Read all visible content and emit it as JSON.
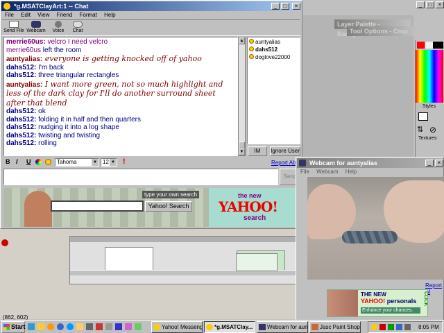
{
  "desktop": {
    "status_coords": "(862, 602)"
  },
  "chat_window": {
    "title": "*g.MSATClayArt:1 -- Chat",
    "menu": [
      "File",
      "Edit",
      "View",
      "Friend",
      "Format",
      "Help"
    ],
    "toolbar": [
      "Send File",
      "Webcam",
      "Voice",
      "Chat"
    ],
    "messages": [
      {
        "name": "merrie60us:",
        "text": " velcro I need velcro",
        "style": "merrie"
      },
      {
        "name": "merrie60us",
        "text": " left the room",
        "style": "system"
      },
      {
        "name": "auntyalias:",
        "text": " everyone is getting knocked off of yahoo",
        "style": "aunty"
      },
      {
        "name": "dahs512:",
        "text": " I'm back",
        "style": "dahs"
      },
      {
        "name": "dahs512:",
        "text": " three triangular rectangles",
        "style": "dahs"
      },
      {
        "name": "auntyalias:",
        "text": " I want more green, not so much highlight and",
        "style": "aunty"
      },
      {
        "name": "",
        "text": " less of the dark clay for I'll do another surround sheet",
        "style": "aunty-cont"
      },
      {
        "name": "",
        "text": " after that blend",
        "style": "aunty-cont"
      },
      {
        "name": "dahs512:",
        "text": " ok",
        "style": "dahs"
      },
      {
        "name": "dahs512:",
        "text": " folding it in half and then quarters",
        "style": "dahs"
      },
      {
        "name": "dahs512:",
        "text": " nudging it into a log shape",
        "style": "dahs"
      },
      {
        "name": "dahs512:",
        "text": " twisting and twisting",
        "style": "dahs"
      },
      {
        "name": "dahs512:",
        "text": " rolling",
        "style": "dahs"
      }
    ],
    "users": [
      "auntyalias",
      "dahs512",
      "doglove22000"
    ],
    "im_button": "IM",
    "ignore_button": "Ignore User",
    "format": {
      "bold": "B",
      "italic": "I",
      "underline": "U",
      "font": "Tahoma",
      "size": "12"
    },
    "report_abuse": "Report Abu",
    "send_label": "Send",
    "ad": {
      "prompt": "type your own search",
      "search_button": "Yahoo! Search",
      "the_new": "the new",
      "brand": "YAHOO!",
      "search": "search"
    }
  },
  "psp": {
    "layer_palette": "Layer Palette - Background",
    "tool_options": "Tool Options - Crop",
    "styles": "Styles",
    "textures": "Textures"
  },
  "webcam": {
    "title": "Webcam for auntyalias",
    "menu": [
      "File",
      "Webcam",
      "Help"
    ],
    "report_abuse": "Report Al",
    "ad": {
      "the_new": "THE NEW",
      "brand": "YAHOO!",
      "personals": "personals",
      "tagline": "Enhance your chances.",
      "click": "CLICK"
    }
  },
  "taskbar": {
    "start": "Start",
    "tasks": [
      "Yahoo! Messenger",
      "*g.MSATClay...",
      "Webcam for aunt...",
      "Jasc Paint Shop ..."
    ],
    "time": "8:05 PM"
  }
}
